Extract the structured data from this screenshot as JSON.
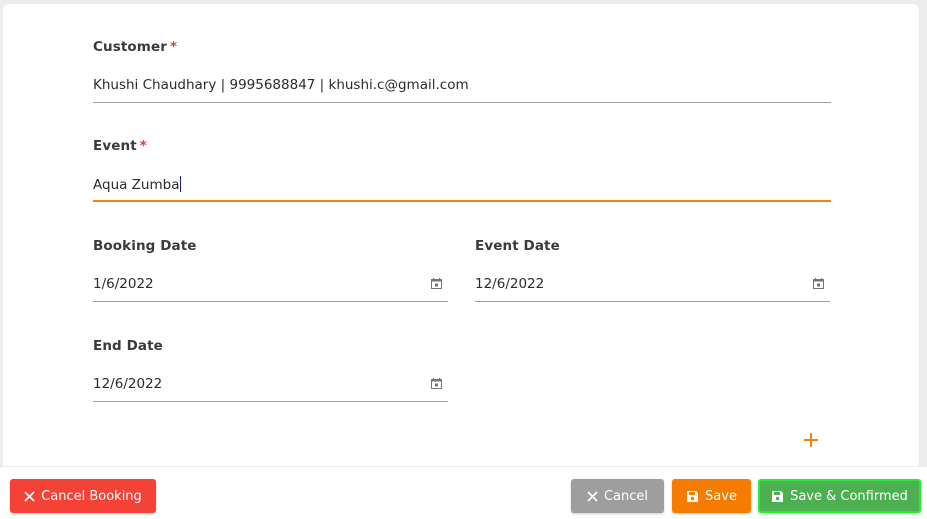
{
  "form": {
    "customer": {
      "label": "Customer",
      "required_mark": "*",
      "value": "Khushi Chaudhary | 9995688847 | khushi.c@gmail.com"
    },
    "event": {
      "label": "Event",
      "required_mark": "*",
      "value": "Aqua Zumba"
    },
    "booking_date": {
      "label": "Booking Date",
      "value": "1/6/2022",
      "icon": "calendar-icon"
    },
    "event_date": {
      "label": "Event Date",
      "value": "12/6/2022",
      "icon": "calendar-icon"
    },
    "end_date": {
      "label": "End Date",
      "value": "12/6/2022",
      "icon": "calendar-icon"
    },
    "add_icon": "plus-icon"
  },
  "footer": {
    "cancel_booking_label": "Cancel Booking",
    "cancel_label": "Cancel",
    "save_label": "Save",
    "save_confirmed_label": "Save & Confirmed"
  },
  "colors": {
    "accent": "#f0830f",
    "danger": "#f44336",
    "neutral": "#9e9e9e",
    "save": "#f57c00",
    "success": "#4caf50",
    "success_outline": "#22ee33",
    "required": "#e53935"
  }
}
